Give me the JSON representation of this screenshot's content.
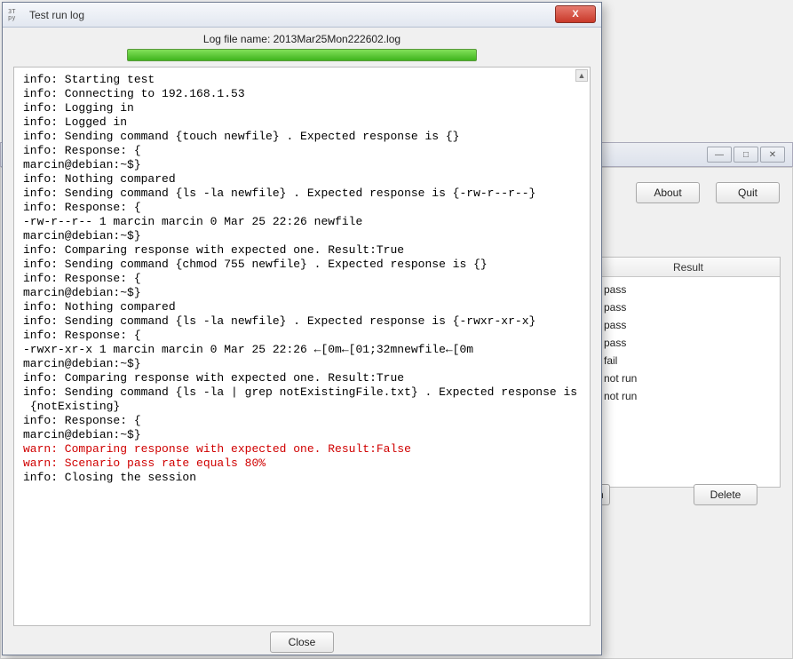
{
  "mainWindow": {
    "buttons": {
      "about": "About",
      "quit": "Quit",
      "delete": "Delete",
      "leftFragment": "n"
    },
    "resultHeader": "Result",
    "results": [
      "pass",
      "pass",
      "pass",
      "pass",
      "fail",
      "not run",
      "not run"
    ],
    "controls": {
      "min": "—",
      "max": "□",
      "close": "✕"
    }
  },
  "dialog": {
    "appIconText": "3T\npy",
    "title": "Test run log",
    "closeX": "X",
    "filenameLabel": "Log file name: 2013Mar25Mon222602.log",
    "closeBtn": "Close",
    "scrollUp": "▲",
    "log": {
      "plain1": "info: Starting test\ninfo: Connecting to 192.168.1.53\ninfo: Logging in\ninfo: Logged in\ninfo: Sending command {touch newfile} . Expected response is {}\ninfo: Response: {\nmarcin@debian:~$}\ninfo: Nothing compared\ninfo: Sending command {ls -la newfile} . Expected response is {-rw-r--r--}\ninfo: Response: {\n-rw-r--r-- 1 marcin marcin 0 Mar 25 22:26 newfile\nmarcin@debian:~$}\ninfo: Comparing response with expected one. Result:True\ninfo: Sending command {chmod 755 newfile} . Expected response is {}\ninfo: Response: {\nmarcin@debian:~$}\ninfo: Nothing compared\ninfo: Sending command {ls -la newfile} . Expected response is {-rwxr-xr-x}\ninfo: Response: {\n-rwxr-xr-x 1 marcin marcin 0 Mar 25 22:26 ←[0m←[01;32mnewfile←[0m\nmarcin@debian:~$}\ninfo: Comparing response with expected one. Result:True\ninfo: Sending command {ls -la | grep notExistingFile.txt} . Expected response is\n {notExisting}\ninfo: Response: {\nmarcin@debian:~$}",
      "warn1": "warn: Comparing response with expected one. Result:False",
      "warn2": "warn: Scenario pass rate equals 80%",
      "plain2": "info: Closing the session"
    }
  }
}
